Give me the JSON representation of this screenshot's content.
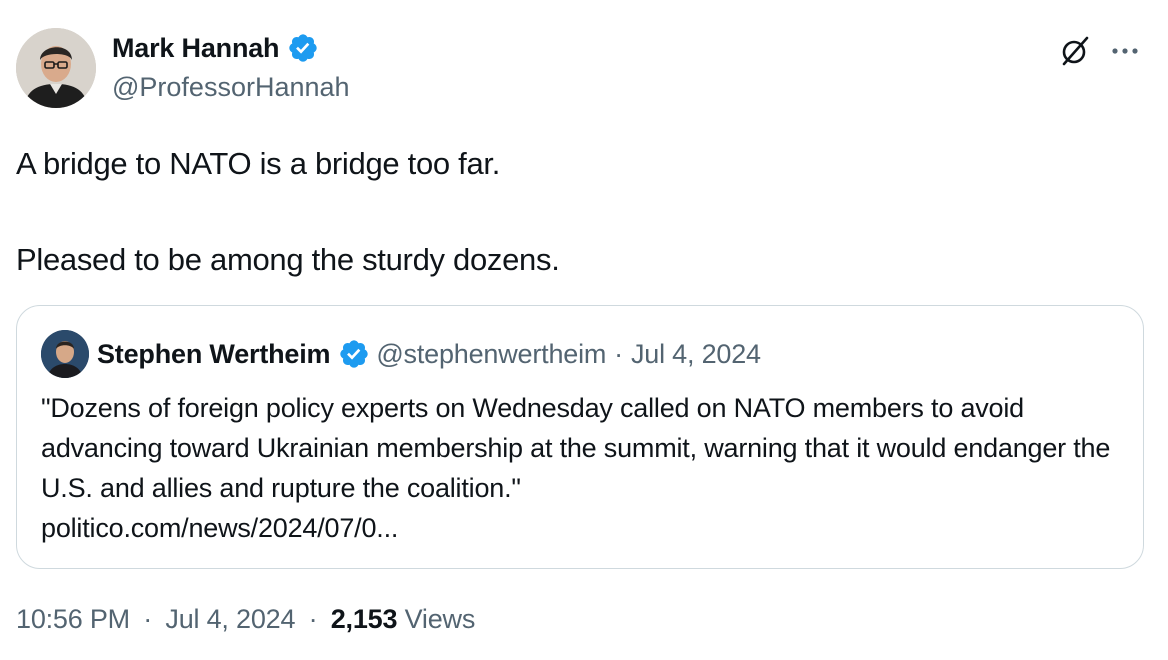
{
  "author": {
    "name": "Mark Hannah",
    "handle": "@ProfessorHannah"
  },
  "tweet": {
    "paragraphs": [
      "A bridge to NATO is a bridge too far.",
      "Pleased to be among the sturdy dozens."
    ]
  },
  "quote": {
    "name": "Stephen Wertheim",
    "handle": "@stephenwertheim",
    "separator": "·",
    "date": "Jul 4, 2024",
    "text": "\"Dozens of foreign policy experts on Wednesday called on NATO members to avoid advancing toward Ukrainian membership at the summit, warning that it would endanger the U.S. and allies and rupture the coalition.\"",
    "link": "politico.com/news/2024/07/0..."
  },
  "meta": {
    "time": "10:56 PM",
    "date": "Jul 4, 2024",
    "separator": "·",
    "views_count": "2,153",
    "views_label": "Views"
  },
  "colors": {
    "verified": "#1d9bf0",
    "secondary_text": "#536471",
    "border": "#cfd9de"
  },
  "icons": [
    "verified-badge-icon",
    "grok-icon",
    "more-icon"
  ]
}
